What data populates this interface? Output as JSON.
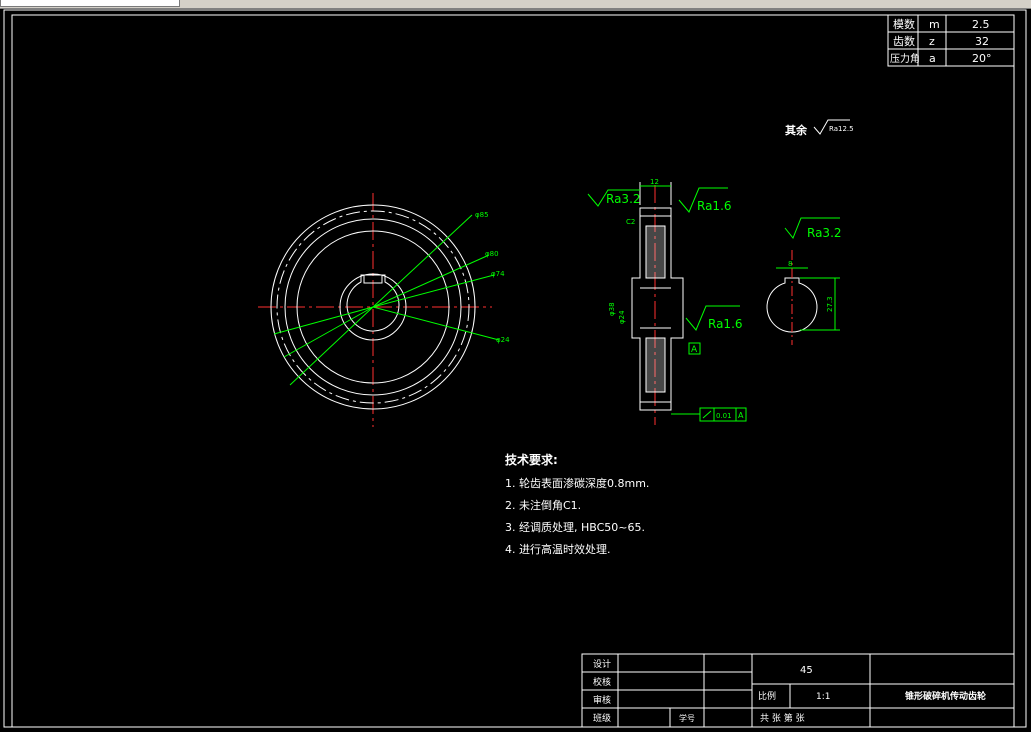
{
  "params_table": [
    {
      "name": "模数",
      "symbol": "m",
      "value": "2.5"
    },
    {
      "name": "齿数",
      "symbol": "z",
      "value": "32"
    },
    {
      "name": "压力角",
      "symbol": "a",
      "value": "20°"
    }
  ],
  "roughness_note": {
    "label": "其余",
    "value": "Ra12.5"
  },
  "dimensions": {
    "width": "12",
    "roughness_face": "Ra3.2",
    "roughness_tooth": "Ra1.6",
    "roughness_bore": "Ra1.6",
    "roughness_keyway": "Ra3.2",
    "datum": "A",
    "runout_tol": "0.01",
    "runout_datum": "A",
    "dia1": "φ85",
    "dia2": "φ80",
    "dia3": "φ74",
    "dia4": "φ24",
    "chamfer": "C2",
    "bore_dim": "φ24",
    "hub_dim": "φ38",
    "key_width": "8",
    "key_depth": "27.3"
  },
  "tech_requirements": {
    "title": "技术要求:",
    "items": [
      "1. 轮齿表面渗碳深度0.8mm.",
      "2. 未注倒角C1.",
      "3. 经调质处理, HBC50~65.",
      "4. 进行高温时效处理."
    ]
  },
  "title_block": {
    "rows": [
      "设计",
      "校核",
      "审核",
      "班级"
    ],
    "student_no_label": "学号",
    "material": "45",
    "scale_label": "比例",
    "scale_value": "1:1",
    "sheets": "共  张  第  张",
    "part_name": "锥形破碎机传动齿轮"
  }
}
